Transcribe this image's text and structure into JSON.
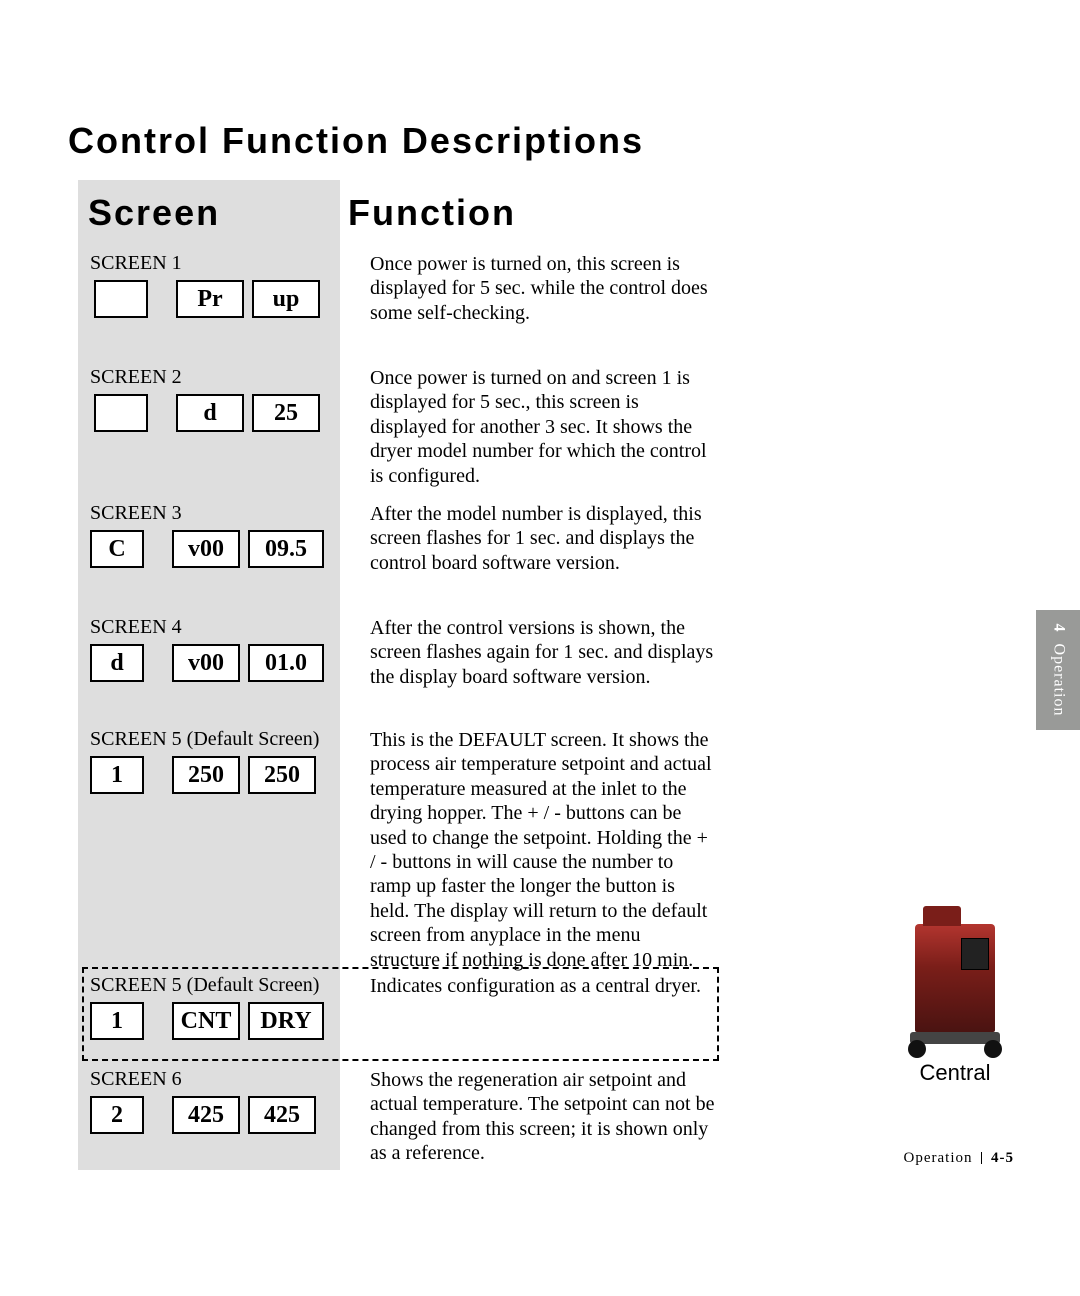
{
  "title": "Control Function Descriptions",
  "headers": {
    "screen": "Screen",
    "function": "Function"
  },
  "side_tab": {
    "number": "4",
    "label": "Operation"
  },
  "footer": {
    "section": "Operation",
    "page": "4-5"
  },
  "central_caption": "Central",
  "screens": [
    {
      "label": "SCREEN 1",
      "cells": [
        "",
        "Pr",
        "up"
      ],
      "function": "Once power is turned on, this screen is displayed for 5 sec. while the control does some self-checking."
    },
    {
      "label": "SCREEN 2",
      "cells": [
        "",
        "d",
        "25"
      ],
      "function": "Once power is turned on and screen 1 is displayed for 5 sec., this screen is displayed for another 3 sec.  It shows the dryer model number for which the control is configured."
    },
    {
      "label": "SCREEN 3",
      "cells": [
        "C",
        "v00",
        "09.5"
      ],
      "function": "After the model number is displayed, this screen flashes for 1 sec. and displays the control board software version."
    },
    {
      "label": "SCREEN 4",
      "cells": [
        "d",
        "v00",
        "01.0"
      ],
      "function": "After the control versions is shown, the screen flashes again for 1 sec. and displays the display board software version."
    },
    {
      "label": "SCREEN 5 (Default Screen)",
      "cells": [
        "1",
        "250",
        "250"
      ],
      "function": "This is the DEFAULT screen.  It shows the process air temperature setpoint and actual temperature measured at the inlet to the drying hopper. The + / - buttons can be used to change the setpoint.  Holding the + / - buttons in will cause the number to ramp up faster the longer the button is held. The display will return to the default screen from anyplace in the menu structure if nothing is done after 10 min."
    },
    {
      "label": "SCREEN 5 (Default Screen)",
      "cells": [
        "1",
        "CNT",
        "DRY"
      ],
      "function": "Indicates configuration as a central dryer."
    },
    {
      "label": "SCREEN 6",
      "cells": [
        "2",
        "425",
        "425"
      ],
      "function": "Shows the regeneration air setpoint and actual temperature. The setpoint can not be changed from this screen; it is shown only as a reference."
    }
  ]
}
